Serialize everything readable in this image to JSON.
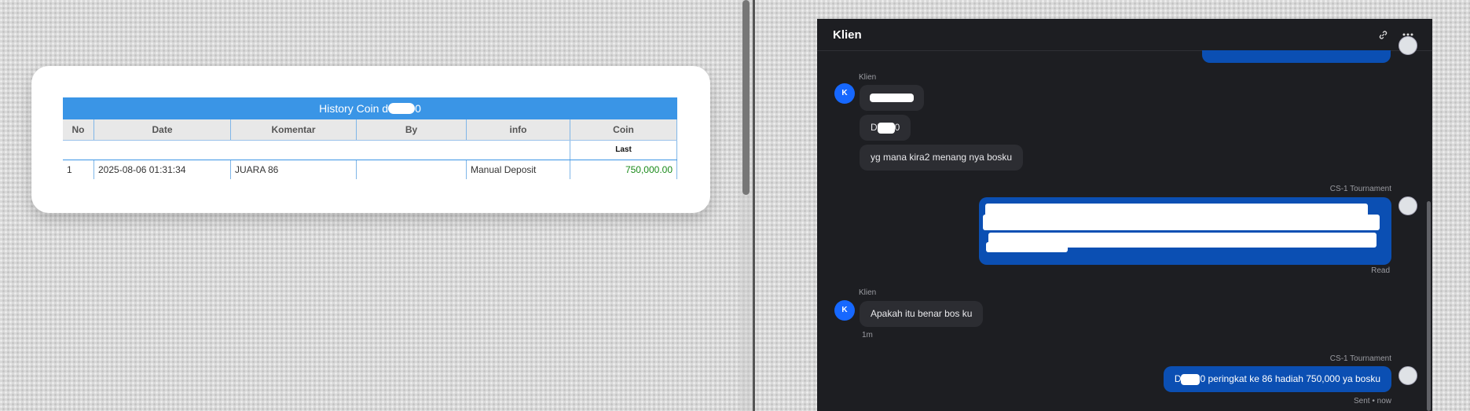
{
  "history_panel": {
    "title": "History Coin d",
    "title_suffix": "0",
    "columns": [
      "No",
      "Date",
      "Komentar",
      "By",
      "info",
      "Coin"
    ],
    "coin_sub_header": "Last",
    "rows": [
      {
        "no": "1",
        "date": "2025-08-06 01:31:34",
        "komentar": "JUARA 86",
        "by": "",
        "info": "Manual Deposit",
        "coin": "750,000.00"
      }
    ]
  },
  "chat": {
    "title": "Klien",
    "header_icons": [
      "link-icon",
      "more-icon"
    ],
    "messages": [
      {
        "sender": "Klien",
        "avatar_initial": "K",
        "texts": [
          "",
          "D",
          "yg mana kira2 menang nya bosku"
        ],
        "mask_suffix": "0"
      },
      {
        "sender": "CS-1 Tournament",
        "status": "Read"
      },
      {
        "sender": "Klien",
        "avatar_initial": "K",
        "text": "Apakah itu benar bos ku",
        "time": "1m"
      },
      {
        "sender": "CS-1 Tournament",
        "text_prefix": "D",
        "text_rest": "0 peringkat ke 86 hadiah 750,000 ya bosku",
        "status": "Sent • now"
      }
    ]
  },
  "colors": {
    "table_header": "#3a95e6",
    "chat_bg": "#1d1e22",
    "outgoing_bubble": "#0b4fb3",
    "avatar": "#1668ff",
    "coin_value": "#1a8a1a"
  }
}
